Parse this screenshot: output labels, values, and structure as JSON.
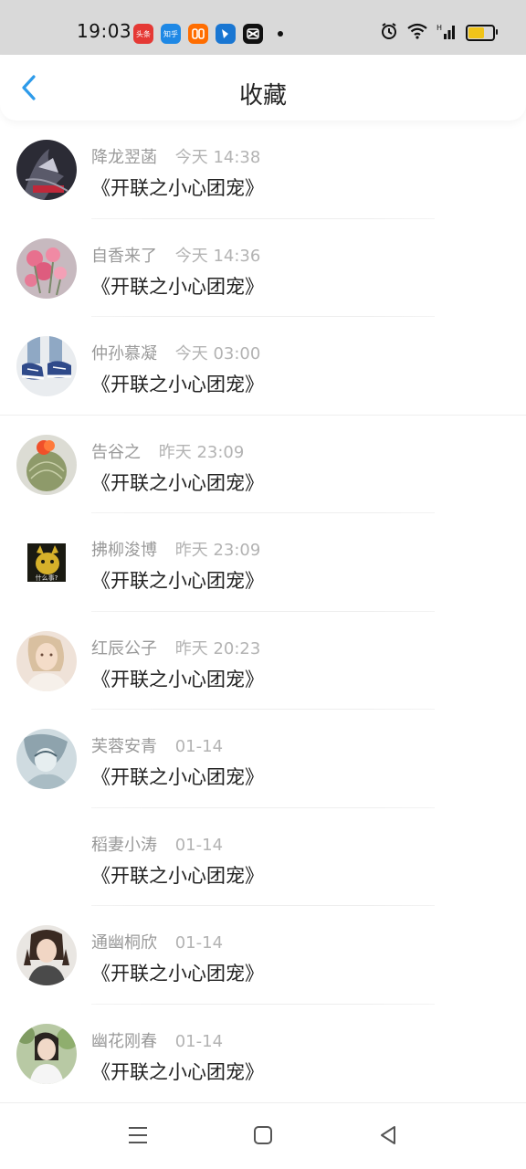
{
  "status_bar": {
    "time": "19:03",
    "notifications": [
      {
        "name": "toutiao-icon",
        "label": "头条",
        "color": "#e53935"
      },
      {
        "name": "zhihu-icon",
        "label": "知乎",
        "color": "#1e88e5"
      },
      {
        "name": "taobao-icon",
        "label": "",
        "color": "#ff6d00"
      },
      {
        "name": "tencent-icon",
        "label": "",
        "color": "#1976d2"
      },
      {
        "name": "capcut-icon",
        "label": "",
        "color": "#111111"
      }
    ],
    "battery_level": 0.6
  },
  "header": {
    "title": "收藏",
    "back_icon": "chevron-left-icon"
  },
  "favorites": [
    {
      "name": "降龙翌菡",
      "time": "今天 14:38",
      "content": "《开联之小心团宠》",
      "avatar": "avatar-dark-motion"
    },
    {
      "name": "自香来了",
      "time": "今天 14:36",
      "content": "《开联之小心团宠》",
      "avatar": "avatar-pink-flowers"
    },
    {
      "name": "仲孙慕凝",
      "time": "今天 03:00",
      "content": "《开联之小心团宠》",
      "avatar": "avatar-sneakers"
    },
    {
      "name": "告谷之",
      "time": "昨天 23:09",
      "content": "《开联之小心团宠》",
      "avatar": "avatar-cactus"
    },
    {
      "name": "拂柳浚博",
      "time": "昨天 23:09",
      "content": "《开联之小心团宠》",
      "avatar": "avatar-pikachu",
      "avatar_caption": "什么事?"
    },
    {
      "name": "红辰公子",
      "time": "昨天 20:23",
      "content": "《开联之小心团宠》",
      "avatar": "avatar-girl-portrait"
    },
    {
      "name": "芙蓉安青",
      "time": "01-14",
      "content": "《开联之小心团宠》",
      "avatar": "avatar-anime-sketch"
    },
    {
      "name": "稻妻小涛",
      "time": "01-14",
      "content": "《开联之小心团宠》",
      "avatar": "avatar-empty"
    },
    {
      "name": "通幽桐欣",
      "time": "01-14",
      "content": "《开联之小心团宠》",
      "avatar": "avatar-girl-pigtails"
    },
    {
      "name": "幽花刚春",
      "time": "01-14",
      "content": "《开联之小心团宠》",
      "avatar": "avatar-girl-outdoor"
    }
  ],
  "colors": {
    "accent": "#2e9bea",
    "name_text": "#9a9a9a",
    "time_text": "#b3b3b3",
    "content_text": "#222222",
    "status_bar_bg": "#d9d9d9"
  }
}
